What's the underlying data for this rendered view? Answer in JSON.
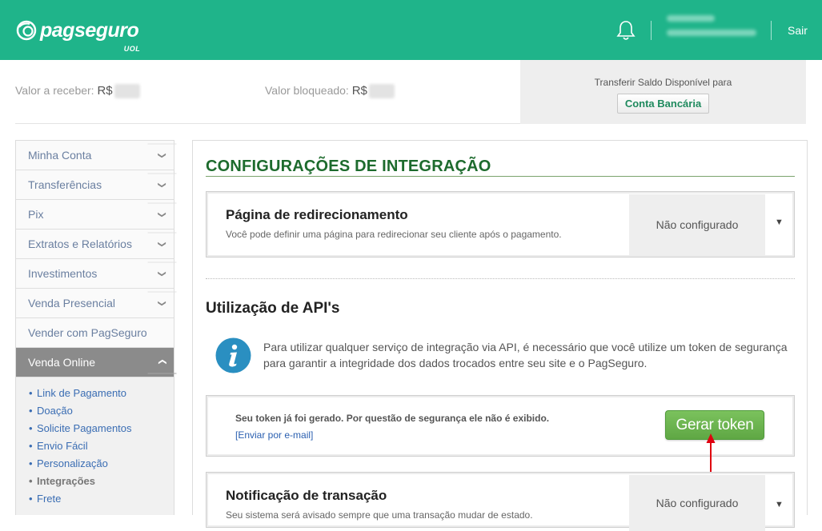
{
  "header": {
    "logo_text": "pagseguro",
    "logo_sub": "UOL",
    "user_name": "",
    "logout": "Sair"
  },
  "balance": {
    "receive_label": "Valor a receber:",
    "currency": "R$",
    "receive_value": "",
    "blocked_label": "Valor bloqueado:",
    "blocked_value": ""
  },
  "transfer": {
    "label": "Transferir Saldo Disponível para",
    "button": "Conta Bancária"
  },
  "sidebar": {
    "items": [
      {
        "label": "Minha Conta"
      },
      {
        "label": "Transferências"
      },
      {
        "label": "Pix"
      },
      {
        "label": "Extratos e Relatórios"
      },
      {
        "label": "Investimentos"
      },
      {
        "label": "Venda Presencial"
      },
      {
        "label": "Vender com PagSeguro"
      },
      {
        "label": "Venda Online"
      }
    ],
    "subitems": [
      {
        "label": "Link de Pagamento"
      },
      {
        "label": "Doação"
      },
      {
        "label": "Solicite Pagamentos"
      },
      {
        "label": "Envio Fácil"
      },
      {
        "label": "Personalização"
      },
      {
        "label": "Integrações"
      },
      {
        "label": "Frete"
      }
    ]
  },
  "main": {
    "title": "CONFIGURAÇÕES DE INTEGRAÇÃO",
    "redirect": {
      "title": "Página de redirecionamento",
      "desc": "Você pode definir uma página para redirecionar seu cliente após o pagamento.",
      "status": "Não configurado"
    },
    "api": {
      "title": "Utilização de API's",
      "info": "Para utilizar qualquer serviço de integração via API, é necessário que você utilize um token de segurança para garantir a integridade dos dados trocados entre seu site e o PagSeguro.",
      "token_msg": "Seu token já foi gerado. Por questão de segurança ele não é exibido.",
      "token_link": "[Enviar por e-mail]",
      "generate_button": "Gerar token"
    },
    "notify": {
      "title": "Notificação de transação",
      "desc": "Seu sistema será avisado sempre que uma transação mudar de estado.",
      "status": "Não configurado"
    }
  },
  "colors": {
    "header": "#1fb48a",
    "title_green": "#1d6b2d",
    "button_green": "#6bb34f",
    "link_blue": "#3a6db3",
    "arrow_red": "#e0000f"
  }
}
